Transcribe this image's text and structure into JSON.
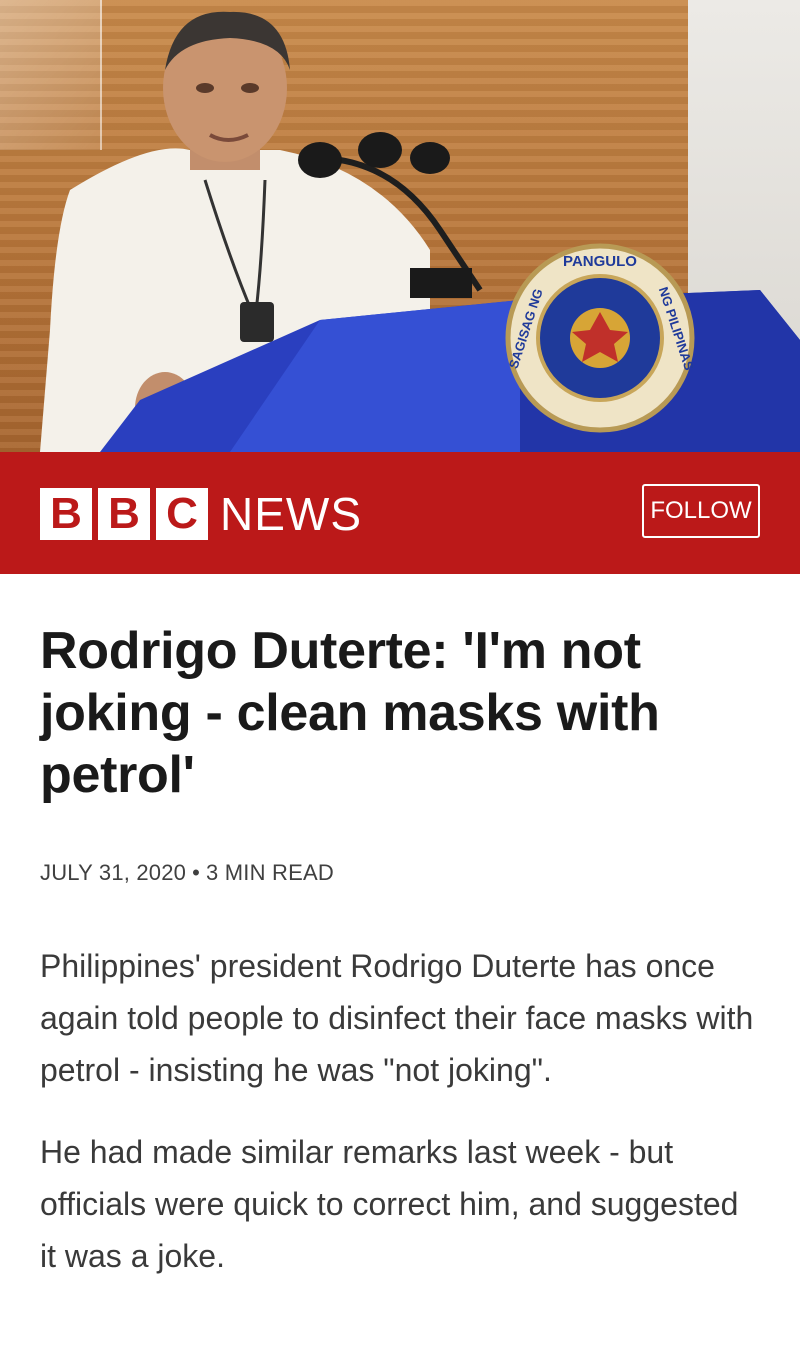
{
  "hero": {
    "seal_text_top": "PANGULO",
    "seal_text_left": "SAGISAG NG",
    "seal_text_right": "NG PILIPINAS"
  },
  "masthead": {
    "logo_letters": [
      "B",
      "B",
      "C"
    ],
    "logo_word": "NEWS",
    "follow_label": "FOLLOW",
    "brand_color": "#bb1919"
  },
  "article": {
    "headline": "Rodrigo Duterte: 'I'm not joking - clean masks with petrol'",
    "date": "JULY 31, 2020",
    "separator": "•",
    "read_time": "3 MIN READ",
    "paragraphs": [
      "Philippines' president Rodrigo Duterte has once again told people to disinfect their face masks with petrol - insisting he was \"not joking\".",
      "He had made similar remarks last week - but officials were quick to correct him, and suggested it was a joke."
    ]
  }
}
